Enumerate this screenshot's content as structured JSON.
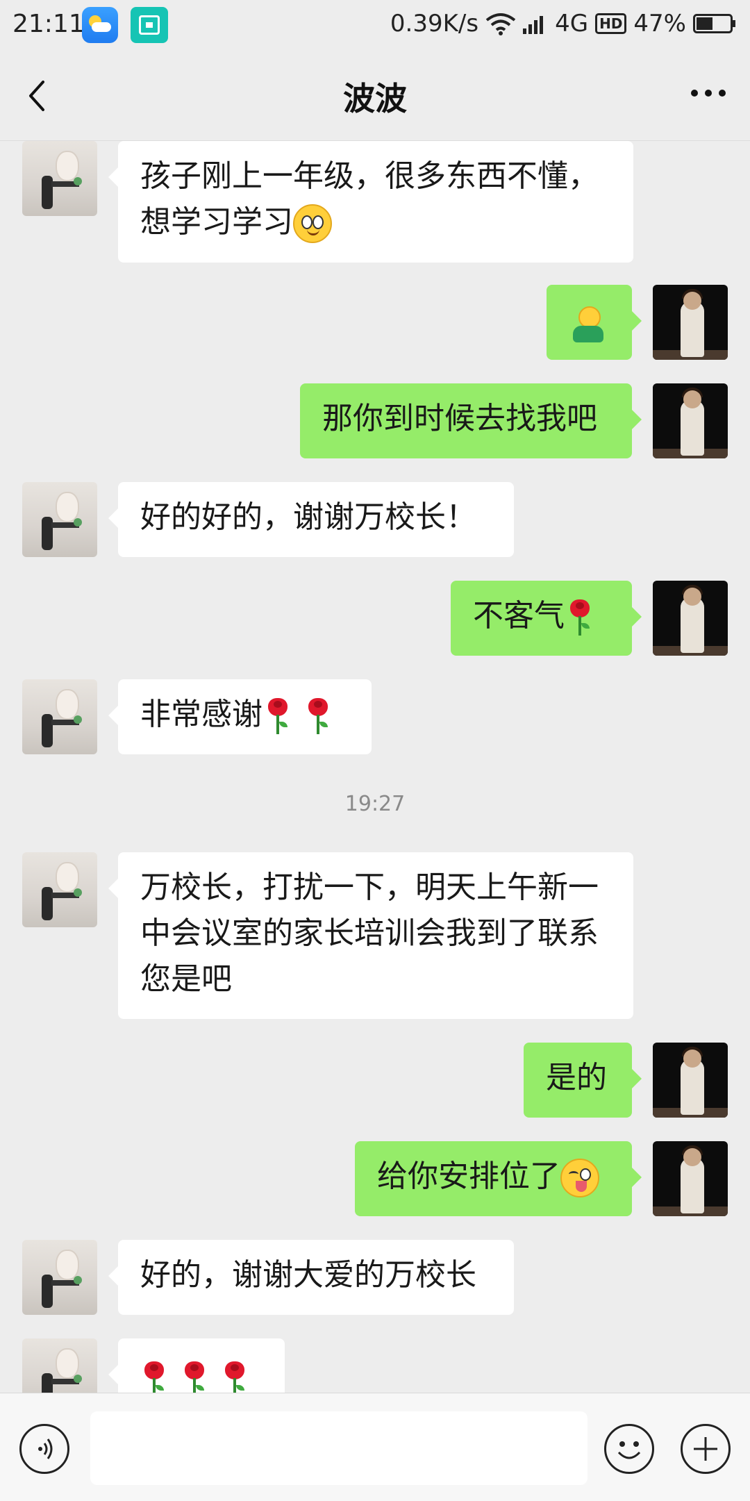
{
  "status_bar": {
    "time": "21:11",
    "network_speed": "0.39K/s",
    "network_type": "4G",
    "hd_label": "HD",
    "battery": "47%"
  },
  "header": {
    "title": "波波"
  },
  "messages": [
    {
      "side": "in",
      "text": "孩子刚上一年级，很多东西不懂，",
      "text2": "想学习学习",
      "emoji": "smile"
    },
    {
      "side": "out",
      "emoji": "buddy"
    },
    {
      "side": "out",
      "text": "那你到时候去找我吧"
    },
    {
      "side": "in",
      "text": "好的好的，谢谢万校长！"
    },
    {
      "side": "out",
      "text": "不客气",
      "emoji": "rose"
    },
    {
      "side": "in",
      "text": "非常感谢",
      "emoji": "rose x2"
    },
    {
      "side": "in",
      "text": "万校长，打扰一下，明天上午新一",
      "text2": "中会议室的家长培训会我到了联系",
      "text3": "您是吧"
    },
    {
      "side": "out",
      "text": "是的"
    },
    {
      "side": "out",
      "text": "给你安排位了",
      "emoji": "wink"
    },
    {
      "side": "in",
      "text": "好的，谢谢大爱的万校长"
    },
    {
      "side": "in",
      "emoji": "rose x3"
    }
  ],
  "timestamp": "19:27",
  "input": {
    "value": ""
  },
  "colors": {
    "background": "#ededed",
    "outgoing_bubble": "#95ec69",
    "incoming_bubble": "#ffffff"
  }
}
